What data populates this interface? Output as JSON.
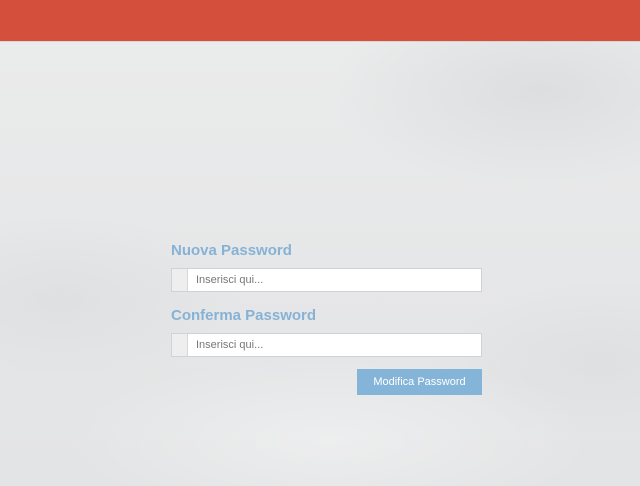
{
  "header": {
    "color": "#d4503d"
  },
  "form": {
    "new_password": {
      "label": "Nuova Password",
      "placeholder": "Inserisci qui...",
      "value": ""
    },
    "confirm_password": {
      "label": "Conferma Password",
      "placeholder": "Inserisci qui...",
      "value": ""
    },
    "submit_label": "Modifica Password"
  },
  "colors": {
    "label": "#86b2d6",
    "button": "#85b4d9",
    "background": "#e9eaeb"
  }
}
